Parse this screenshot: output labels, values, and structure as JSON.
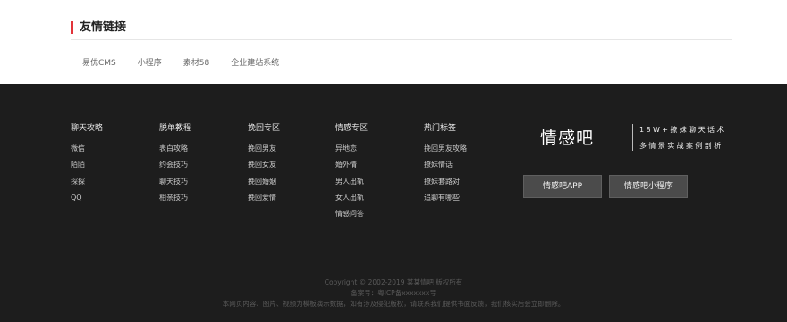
{
  "friend_links": {
    "title": "友情链接",
    "accent_color": "#e2333a",
    "items": [
      "易优CMS",
      "小程序",
      "素材58",
      "企业建站系统"
    ]
  },
  "footer": {
    "background": "#1d1d1d",
    "columns": [
      {
        "title": "聊天攻略",
        "items": [
          "微信",
          "陌陌",
          "探探",
          "QQ"
        ]
      },
      {
        "title": "脱单教程",
        "items": [
          "表白攻略",
          "约会技巧",
          "聊天技巧",
          "相亲技巧"
        ]
      },
      {
        "title": "挽回专区",
        "items": [
          "挽回男友",
          "挽回女友",
          "挽回婚姻",
          "挽回爱情"
        ]
      },
      {
        "title": "情感专区",
        "items": [
          "异地恋",
          "婚外情",
          "男人出轨",
          "女人出轨",
          "情感问答"
        ]
      },
      {
        "title": "热门标签",
        "items": [
          "挽回男友攻略",
          "撩妹情话",
          "撩妹套路对",
          "追聊有哪些"
        ]
      }
    ],
    "brand": {
      "name": "情感吧",
      "tagline_1": "18W+撩妹聊天话术",
      "tagline_2": "多情景实战案例剖析"
    },
    "buttons": {
      "app": "情感吧APP",
      "mini_program": "情感吧小程序"
    },
    "copyright": {
      "line1": "Copyright © 2002-2019 某某情吧 版权所有",
      "line2": "备案号：粤ICP备xxxxxxx号",
      "line3": "本网页内容、图片、视频为模板演示数据，如有涉及侵犯版权，请联系我们提供书面反馈，我们核实后会立即删除。"
    }
  }
}
